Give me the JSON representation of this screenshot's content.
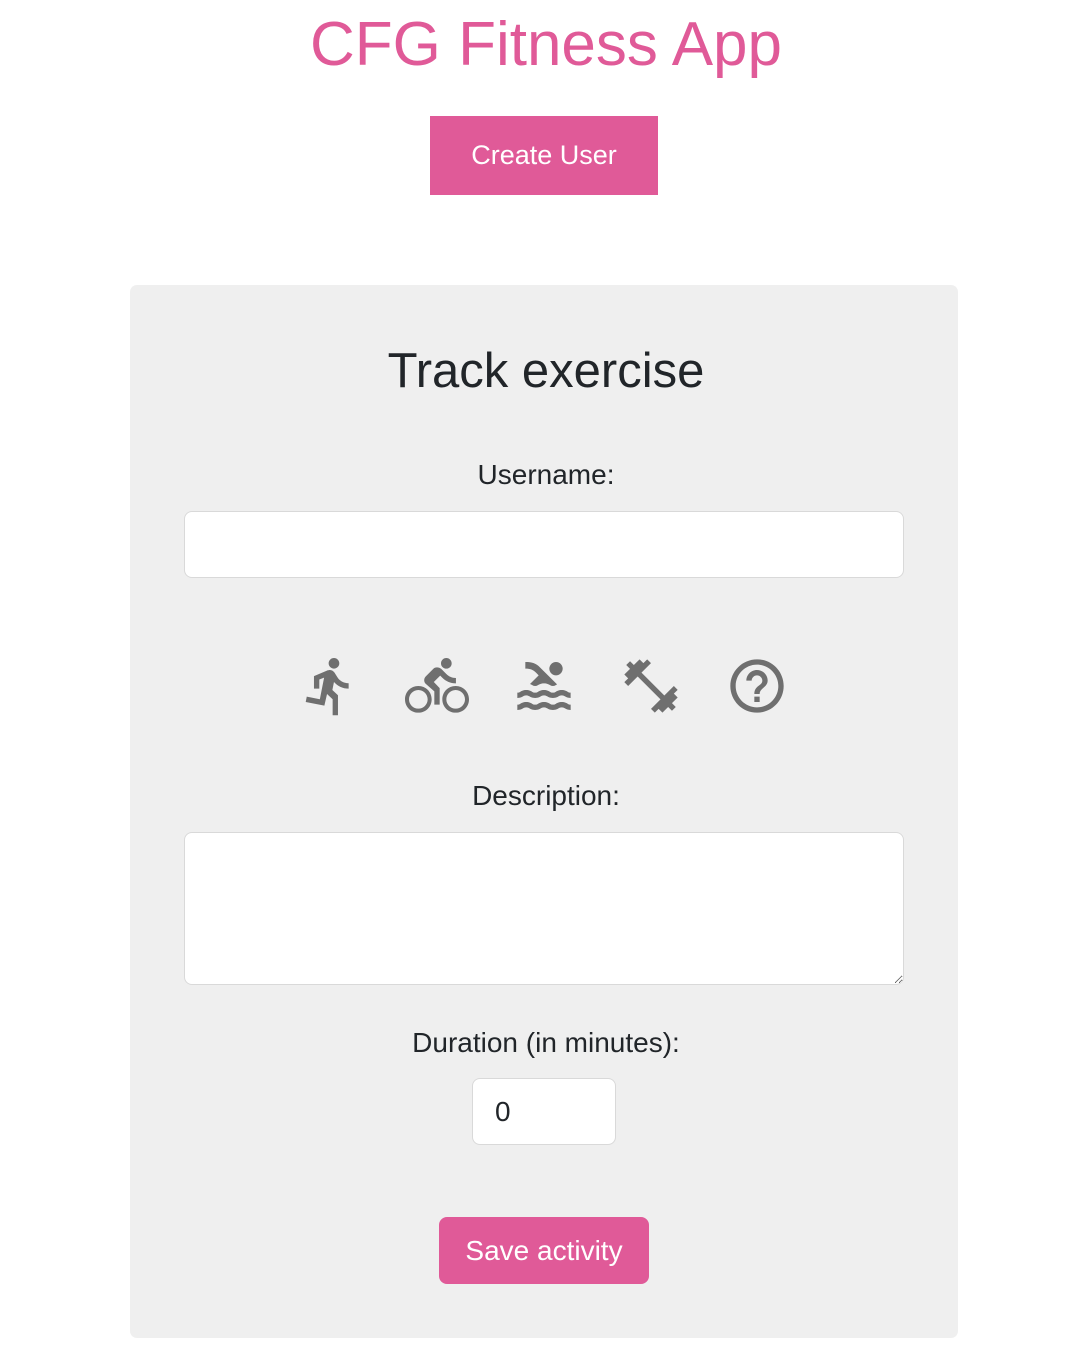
{
  "app": {
    "title": "CFG Fitness App",
    "create_user_label": "Create User"
  },
  "colors": {
    "accent": "#e05a98",
    "icon": "#6f6f6f",
    "card_bg": "#efefef"
  },
  "form": {
    "title": "Track exercise",
    "username_label": "Username:",
    "username_value": "",
    "description_label": "Description:",
    "description_value": "",
    "duration_label": "Duration (in minutes):",
    "duration_value": "0",
    "save_label": "Save activity"
  },
  "activities": [
    {
      "icon": "running-icon"
    },
    {
      "icon": "cycling-icon"
    },
    {
      "icon": "swimming-icon"
    },
    {
      "icon": "gym-icon"
    },
    {
      "icon": "other-icon"
    }
  ]
}
